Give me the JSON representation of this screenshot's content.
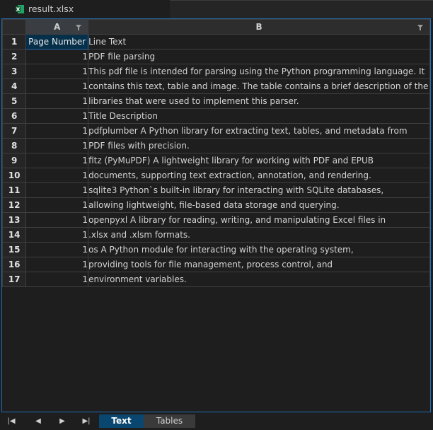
{
  "editor": {
    "file_tab": {
      "name": "result.xlsx",
      "icon": "excel-file-icon"
    }
  },
  "sheet": {
    "columns": [
      {
        "letter": "A",
        "filter_icon": "filter-icon"
      },
      {
        "letter": "B",
        "filter_icon": "filter-icon"
      }
    ],
    "rows": [
      {
        "num": "1",
        "a": "Page Number",
        "b": "Line Text"
      },
      {
        "num": "2",
        "a": "1",
        "b": "PDF file parsing"
      },
      {
        "num": "3",
        "a": "1",
        "b": "This pdf file is intended for parsing using the Python programming language. It"
      },
      {
        "num": "4",
        "a": "1",
        "b": "contains this text, table and image. The table contains a brief description of the"
      },
      {
        "num": "5",
        "a": "1",
        "b": "libraries that were used to implement this parser."
      },
      {
        "num": "6",
        "a": "1",
        "b": "Title Description"
      },
      {
        "num": "7",
        "a": "1",
        "b": "pdfplumber A Python library for extracting text, tables, and metadata from"
      },
      {
        "num": "8",
        "a": "1",
        "b": "PDF files with precision."
      },
      {
        "num": "9",
        "a": "1",
        "b": "fitz (PyMuPDF) A lightweight library for working with PDF and EPUB"
      },
      {
        "num": "10",
        "a": "1",
        "b": "documents, supporting text extraction, annotation, and rendering."
      },
      {
        "num": "11",
        "a": "1",
        "b": "sqlite3 Python`s built-in library for interacting with SQLite databases,"
      },
      {
        "num": "12",
        "a": "1",
        "b": "allowing lightweight, file-based data storage and querying."
      },
      {
        "num": "13",
        "a": "1",
        "b": "openpyxl A library for reading, writing, and manipulating Excel files in"
      },
      {
        "num": "14",
        "a": "1",
        "b": ".xlsx and .xlsm formats."
      },
      {
        "num": "15",
        "a": "1",
        "b": "os A Python module for interacting with the operating system,"
      },
      {
        "num": "16",
        "a": "1",
        "b": "providing tools for file management, process control, and"
      },
      {
        "num": "17",
        "a": "1",
        "b": "environment variables."
      }
    ]
  },
  "sheet_tabs": {
    "navigation": [
      "first-sheet-icon",
      "previous-sheet-icon",
      "next-sheet-icon",
      "last-sheet-icon"
    ],
    "tabs": [
      {
        "label": "Text",
        "active": true
      },
      {
        "label": "Tables",
        "active": false
      }
    ]
  },
  "colors": {
    "selection_border": "#1f6fb5",
    "selected_cell_bg": "#062f4a",
    "active_tab_bg": "#094771",
    "excel_green": "#1d7a45"
  }
}
